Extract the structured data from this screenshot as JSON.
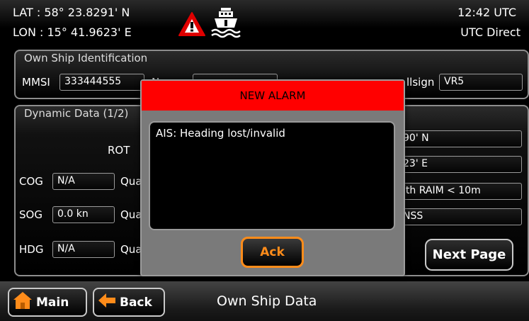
{
  "header": {
    "lat": "LAT : 58° 23.8291' N",
    "lon": "LON : 15° 41.9623' E",
    "time": "12:42 UTC",
    "time_source": "UTC Direct",
    "alarm_icon": "warning-triangle-icon",
    "ship_icon": "ship-icon"
  },
  "own_ship": {
    "title": "Own Ship Identification",
    "mmsi_label": "MMSI",
    "mmsi_value": "333444555",
    "name_label": "N",
    "callsign_label": "llsign",
    "callsign_value": "VR5"
  },
  "dynamic": {
    "title": "Dynamic Data (1/2)",
    "rot_label": "ROT",
    "cog_label": "COG",
    "cog_value": "N/A",
    "sog_label": "SOG",
    "sog_value": "0.0 kn",
    "hdg_label": "HDG",
    "hdg_value": "N/A",
    "qual_label": "Qua",
    "lat_value": "90' N",
    "lon_value": "23' E",
    "accuracy_value": "ith RAIM < 10m",
    "source_value": "NSS",
    "next_page_label": "Next Page"
  },
  "footer": {
    "main_label": "Main",
    "back_label": "Back",
    "screen_title": "Own Ship Data"
  },
  "alarm": {
    "title": "NEW ALARM",
    "message": "AIS: Heading lost/invalid",
    "ack_label": "Ack",
    "header_color": "#ff0000",
    "accent_color": "#ff8c1a"
  }
}
